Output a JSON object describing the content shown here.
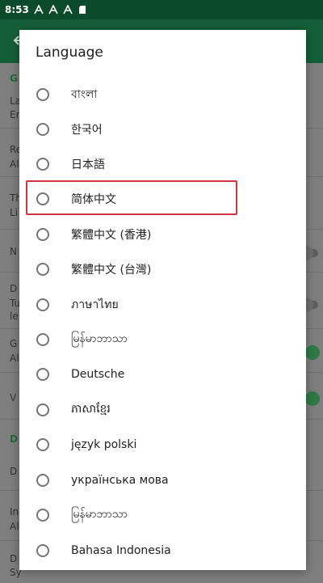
{
  "status_bar": {
    "time": "8:53",
    "icons": [
      "font-A-icon",
      "font-A-icon",
      "font-A-icon",
      "sim-icon"
    ]
  },
  "dialog": {
    "title": "Language",
    "options": [
      {
        "label": "বাংলা",
        "selected": false
      },
      {
        "label": "한국어",
        "selected": false
      },
      {
        "label": "日本語",
        "selected": false
      },
      {
        "label": "简体中文",
        "selected": false
      },
      {
        "label": "繁體中文 (香港)",
        "selected": false
      },
      {
        "label": "繁體中文 (台灣)",
        "selected": false
      },
      {
        "label": "ภาษาไทย",
        "selected": false
      },
      {
        "label": "မြန်မာဘာသာ",
        "selected": false
      },
      {
        "label": "Deutsche",
        "selected": false
      },
      {
        "label": "ភាសាខ្មែរ",
        "selected": false
      },
      {
        "label": "język polski",
        "selected": false
      },
      {
        "label": "українська мова",
        "selected": false
      },
      {
        "label": "မြန်မာဘာသာ",
        "selected": false
      },
      {
        "label": "Bahasa Indonesia",
        "selected": false
      }
    ]
  },
  "background": {
    "stubs": [
      {
        "text": "G",
        "green": true
      },
      {
        "text": "La",
        "green": false
      },
      {
        "text": "Er",
        "green": false
      },
      {
        "text": "Re",
        "green": false
      },
      {
        "text": "Al",
        "green": false
      },
      {
        "text": "Th",
        "green": false
      },
      {
        "text": "Li",
        "green": false
      },
      {
        "text": "N",
        "green": false
      },
      {
        "text": "D",
        "green": false
      },
      {
        "text": "Tu",
        "green": false
      },
      {
        "text": "le",
        "green": false
      },
      {
        "text": "G",
        "green": false
      },
      {
        "text": "Al",
        "green": false
      },
      {
        "text": "V",
        "green": false
      },
      {
        "text": "D",
        "green": true
      },
      {
        "text": "D",
        "green": false
      },
      {
        "text": "In",
        "green": false
      },
      {
        "text": "Al",
        "green": false
      },
      {
        "text": "D",
        "green": false
      },
      {
        "text": "Sy",
        "green": false
      }
    ]
  },
  "colors": {
    "status_bar": "#0b4a2a",
    "app_bar": "#145f38",
    "highlight": "#d0343f",
    "accent_green": "#1f6b3a"
  }
}
